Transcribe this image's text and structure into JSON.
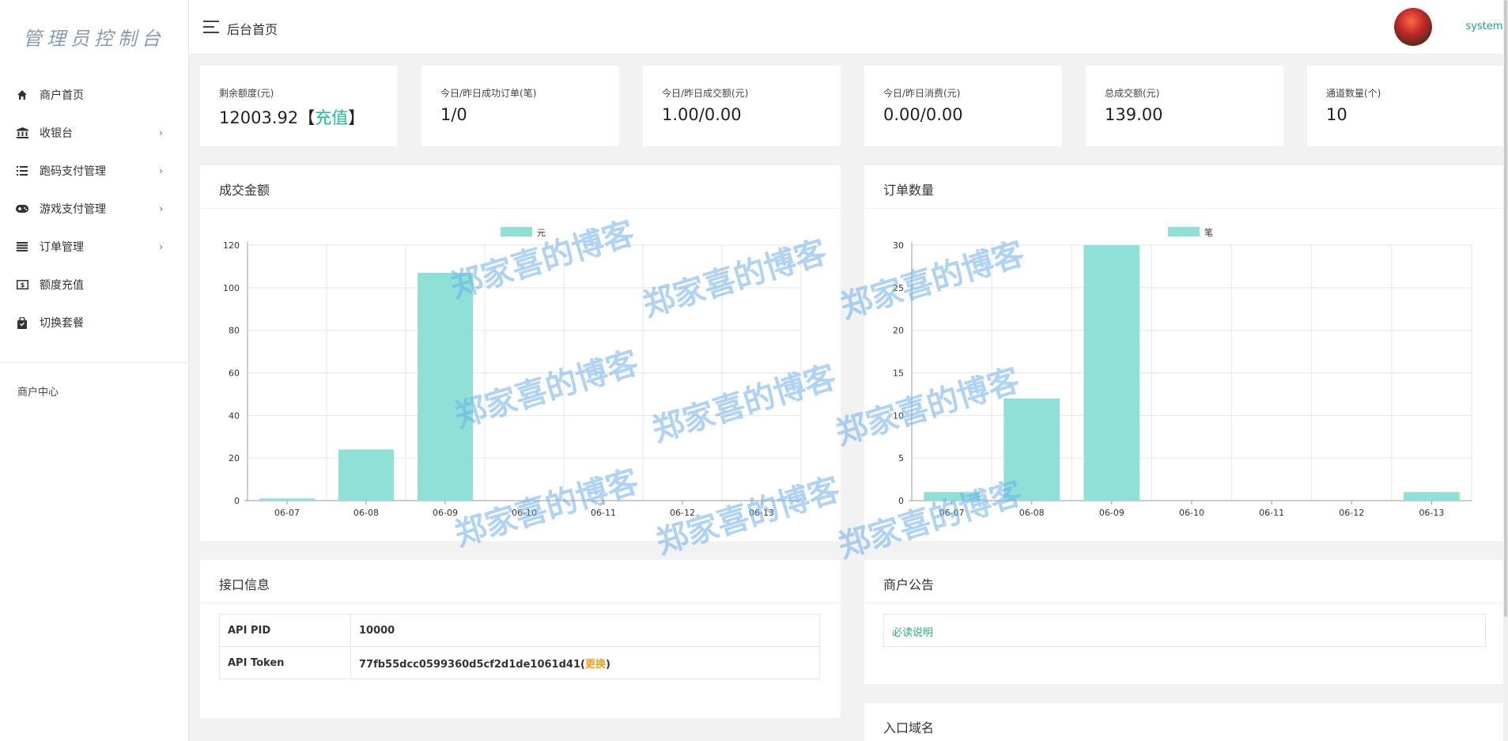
{
  "sidebar": {
    "logo": "管理员控制台",
    "items": [
      {
        "label": "商户首页",
        "icon": "home-icon",
        "arrow": false
      },
      {
        "label": "收银台",
        "icon": "bank-icon",
        "arrow": true
      },
      {
        "label": "跑码支付管理",
        "icon": "list-icon",
        "arrow": true
      },
      {
        "label": "游戏支付管理",
        "icon": "gamepad-icon",
        "arrow": true
      },
      {
        "label": "订单管理",
        "icon": "menu-lines-icon",
        "arrow": true
      },
      {
        "label": "额度充值",
        "icon": "money-icon",
        "arrow": false
      },
      {
        "label": "切换套餐",
        "icon": "bag-icon",
        "arrow": false
      }
    ],
    "section": "商户中心"
  },
  "topbar": {
    "breadcrumb": "后台首页",
    "user": "system▾"
  },
  "stats": [
    {
      "label": "剩余额度(元)",
      "value": "12003.92",
      "extra_open": "【",
      "extra_link": "充值",
      "extra_close": "】"
    },
    {
      "label": "今日/昨日成功订单(笔)",
      "value": "1/0"
    },
    {
      "label": "今日/昨日成交额(元)",
      "value": "1.00/0.00"
    },
    {
      "label": "今日/昨日消费(元)",
      "value": "0.00/0.00"
    },
    {
      "label": "总成交额(元)",
      "value": "139.00"
    },
    {
      "label": "通道数量(个)",
      "value": "10"
    }
  ],
  "panels": {
    "amount_title": "成交金额",
    "orders_title": "订单数量",
    "api_title": "接口信息",
    "notice_title": "商户公告",
    "domain_title": "入口域名"
  },
  "api": {
    "rows": [
      {
        "key": "API PID",
        "value": "10000"
      },
      {
        "key": "API Token",
        "value": "77fb55dcc0599360d5cf2d1de1061d41",
        "link": "更换"
      }
    ]
  },
  "notice": {
    "text": "必读说明"
  },
  "watermark": "郑家喜的博客",
  "chart_data": [
    {
      "type": "bar",
      "categories": [
        "06-07",
        "06-08",
        "06-09",
        "06-10",
        "06-11",
        "06-12",
        "06-13"
      ],
      "series": [
        {
          "name": "元",
          "values": [
            1,
            24,
            107,
            0,
            0,
            0,
            0
          ]
        }
      ],
      "ylim": [
        0,
        120
      ],
      "yticks": [
        0,
        20,
        40,
        60,
        80,
        100,
        120
      ],
      "color": "#8fe0d6",
      "grid": true,
      "legend": "top-center"
    },
    {
      "type": "bar",
      "categories": [
        "06-07",
        "06-08",
        "06-09",
        "06-10",
        "06-11",
        "06-12",
        "06-13"
      ],
      "series": [
        {
          "name": "笔",
          "values": [
            1,
            12,
            30,
            0,
            0,
            0,
            1
          ]
        }
      ],
      "ylim": [
        0,
        30
      ],
      "yticks": [
        0,
        5,
        10,
        15,
        20,
        25,
        30
      ],
      "color": "#8fe0d6",
      "grid": true,
      "legend": "top-center"
    }
  ]
}
